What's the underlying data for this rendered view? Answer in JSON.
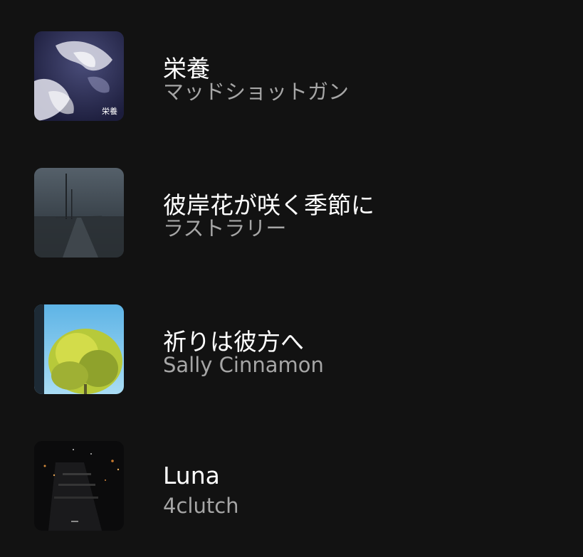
{
  "tracks": [
    {
      "title": "栄養",
      "artist": "マッドショットガン",
      "cover_text": "栄養",
      "cover_icon": "album-cover-clouds-icon"
    },
    {
      "title": "彼岸花が咲く季節に",
      "artist": "ラストラリー",
      "cover_icon": "album-cover-foggy-road-icon"
    },
    {
      "title": "祈りは彼方へ",
      "artist": "Sally Cinnamon",
      "cover_icon": "album-cover-tree-sky-icon"
    },
    {
      "title": "Luna",
      "artist": "4clutch",
      "cover_icon": "album-cover-night-city-icon"
    }
  ],
  "colors": {
    "background": "#121212",
    "title": "#ffffff",
    "artist": "#a6a6a6"
  }
}
